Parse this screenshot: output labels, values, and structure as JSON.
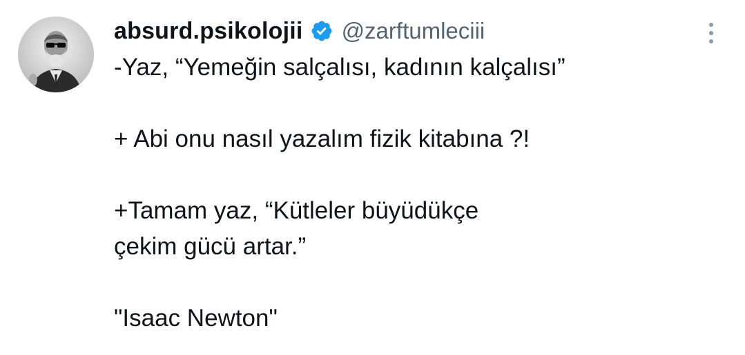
{
  "tweet": {
    "author": {
      "display_name": "absurd.psikolojii",
      "handle": "@zarftumleciii",
      "verified": true,
      "avatar_icon": "bearded-man-sunglasses-avatar"
    },
    "body_lines": [
      "-Yaz, “Yemeğin salçalısı, kadının kalçalısı”",
      "+ Abi onu nasıl yazalım fizik kitabına ?!",
      "+Tamam yaz, “Kütleler büyüdükçe",
      "çekim gücü artar.”",
      "\"Isaac Newton\""
    ],
    "more_icon": "more-vertical-icon"
  },
  "colors": {
    "text_primary": "#0f1419",
    "text_secondary": "#536471",
    "verified_blue": "#1d9bf0",
    "background": "#ffffff"
  }
}
